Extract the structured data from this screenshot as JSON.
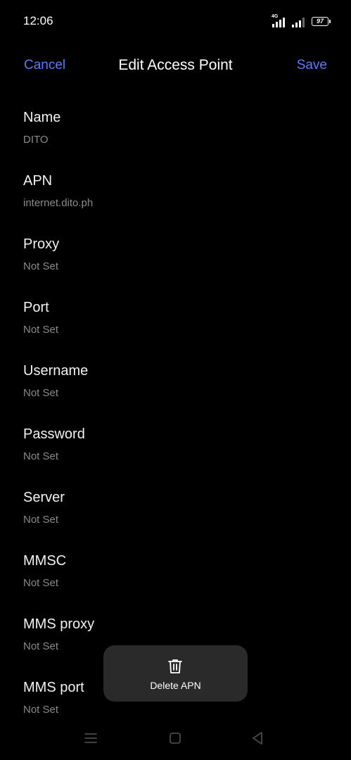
{
  "status_bar": {
    "time": "12:06",
    "network_type": "4G",
    "battery_level": "97",
    "icons": [
      "signal-4g-icon",
      "signal-icon",
      "battery-icon"
    ]
  },
  "header": {
    "cancel_label": "Cancel",
    "title": "Edit Access Point",
    "save_label": "Save",
    "accent_color": "#5b7cf7"
  },
  "settings": [
    {
      "label": "Name",
      "value": "DITO"
    },
    {
      "label": "APN",
      "value": "internet.dito.ph"
    },
    {
      "label": "Proxy",
      "value": "Not Set"
    },
    {
      "label": "Port",
      "value": "Not Set"
    },
    {
      "label": "Username",
      "value": "Not Set"
    },
    {
      "label": "Password",
      "value": "Not Set"
    },
    {
      "label": "Server",
      "value": "Not Set"
    },
    {
      "label": "MMSC",
      "value": "Not Set"
    },
    {
      "label": "MMS proxy",
      "value": "Not Set"
    },
    {
      "label": "MMS port",
      "value": "Not Set"
    }
  ],
  "delete_popup": {
    "icon": "trash-icon",
    "label": "Delete APN"
  },
  "nav_bar": {
    "icons": [
      "menu-icon",
      "home-icon",
      "back-icon"
    ]
  }
}
